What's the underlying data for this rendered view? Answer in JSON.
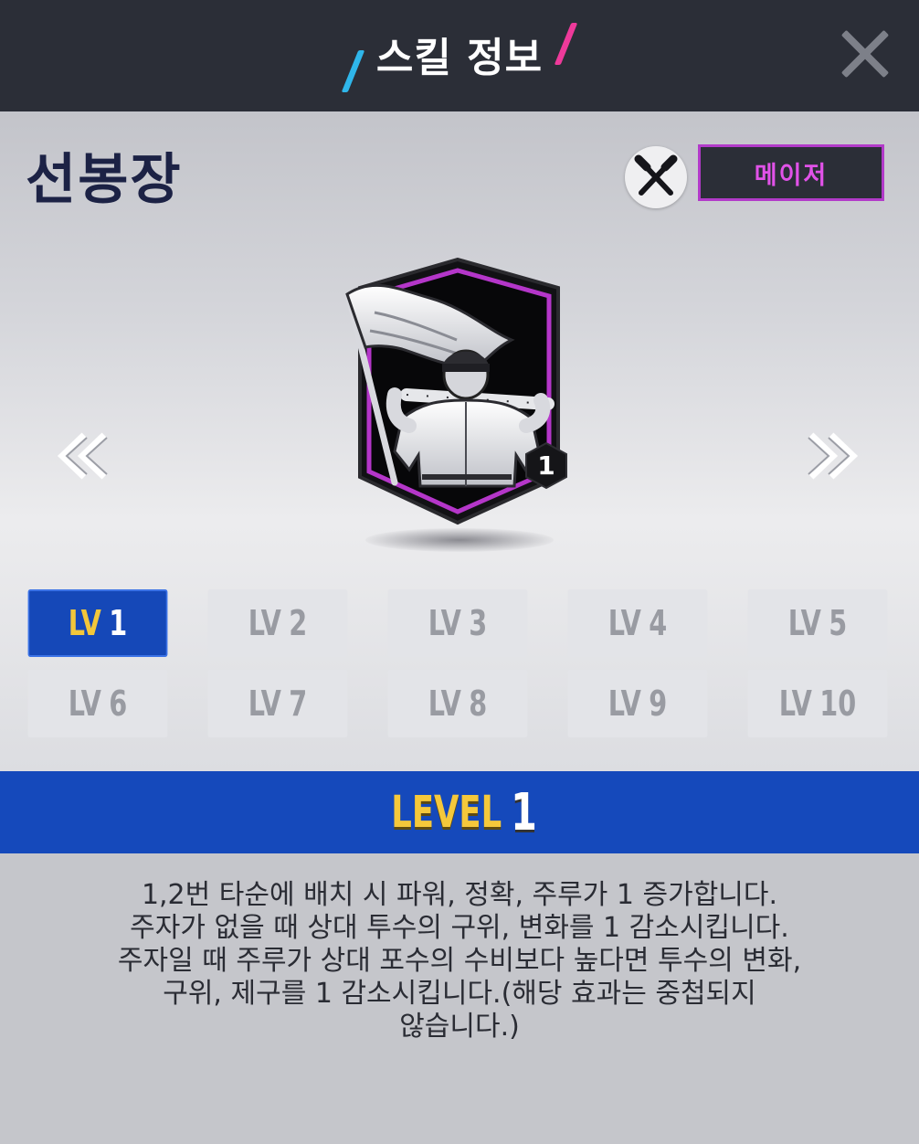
{
  "header": {
    "title": "스킬 정보",
    "close_icon": "close-icon",
    "accent_colors": {
      "left_slash": "#2fb6ea",
      "right_slash": "#ee3a9a"
    }
  },
  "skill": {
    "name": "선봉장",
    "type_icon": "crossed-bats-icon",
    "grade_badge": "메이저",
    "card_level_badge": "1",
    "card_icon": "flag-bearer-batter-icon"
  },
  "navigation": {
    "prev_icon": "double-chevron-left-icon",
    "next_icon": "double-chevron-right-icon"
  },
  "levels": [
    {
      "prefix": "LV",
      "num": "1",
      "active": true
    },
    {
      "prefix": "LV",
      "num": "2",
      "active": false
    },
    {
      "prefix": "LV",
      "num": "3",
      "active": false
    },
    {
      "prefix": "LV",
      "num": "4",
      "active": false
    },
    {
      "prefix": "LV",
      "num": "5",
      "active": false
    },
    {
      "prefix": "LV",
      "num": "6",
      "active": false
    },
    {
      "prefix": "LV",
      "num": "7",
      "active": false
    },
    {
      "prefix": "LV",
      "num": "8",
      "active": false
    },
    {
      "prefix": "LV",
      "num": "9",
      "active": false
    },
    {
      "prefix": "LV",
      "num": "10",
      "active": false
    }
  ],
  "selected_level": {
    "label": "LEVEL",
    "number": "1"
  },
  "description": "1,2번 타순에 배치 시 파워, 정확, 주루가 1 증가합니다.\n주자가 없을 때 상대 투수의 구위, 변화를 1 감소시킵니다.\n주자일 때 주루가 상대 포수의 수비보다 높다면 투수의 변화,\n구위, 제구를 1 감소시킵니다.(해당 효과는 중첩되지\n않습니다.)",
  "colors": {
    "header_bg": "#2b2e37",
    "active_level_bg": "#1548b8",
    "level_bar_bg": "#1549bb",
    "level_label": "#f5c83b",
    "grade_border": "#b23ac9",
    "grade_text": "#e152e8"
  }
}
